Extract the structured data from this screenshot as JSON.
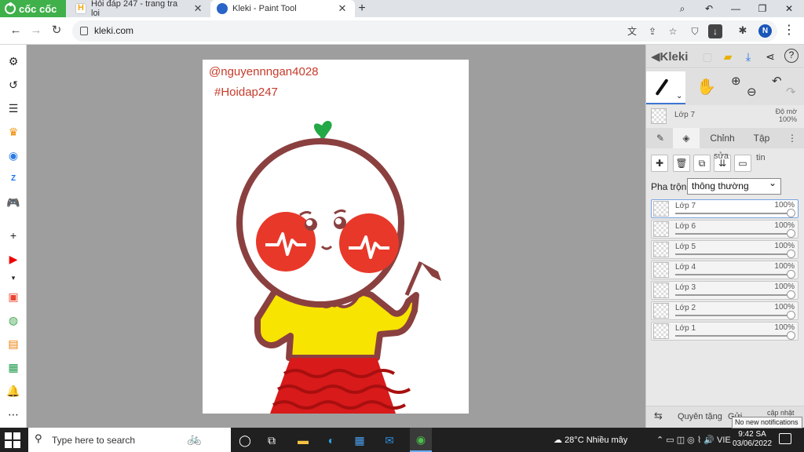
{
  "browser": {
    "brand": "cốc cốc",
    "tabs": [
      {
        "title": "Hỏi đáp 247 - trang tra loi"
      },
      {
        "title": "Kleki - Paint Tool"
      }
    ],
    "url": "kleki.com",
    "profile_initial": "N"
  },
  "canvas": {
    "watermark_1": "@nguyennngan4028",
    "watermark_2": "#Hoidap247"
  },
  "panel": {
    "logo": "Kleki",
    "current_layer": "Lớp 7",
    "opacity_label": [
      "Độ mờ",
      "100%"
    ],
    "tabs": {
      "adjust": "Chỉnh",
      "file": "Tập"
    },
    "toolbar_labels": {
      "edit": "sửa",
      "info": "tin"
    },
    "blend_label": "Pha trộn",
    "blend_value": "thông thường",
    "layers": [
      {
        "name": "Lớp 7",
        "opacity": "100%",
        "active": true
      },
      {
        "name": "Lớp 6",
        "opacity": "100%"
      },
      {
        "name": "Lớp 5",
        "opacity": "100%"
      },
      {
        "name": "Lớp 4",
        "opacity": "100%"
      },
      {
        "name": "Lớp 3",
        "opacity": "100%"
      },
      {
        "name": "Lớp 2",
        "opacity": "100%"
      },
      {
        "name": "Lớp 1",
        "opacity": "100%"
      }
    ],
    "footer": {
      "rotate": "Quyên tặng",
      "help": "Gửi",
      "update": "cập nhật"
    }
  },
  "taskbar": {
    "search_placeholder": "Type here to search",
    "weather": "28°C  Nhiều mây",
    "lang": "VIE",
    "time": "9:42 SA",
    "date": "03/06/2022",
    "tooltip": "No new notifications"
  },
  "colors": {
    "brand_green": "#3fb04a",
    "outline": "#8b4040",
    "shirt": "#f7e400",
    "blush": "#e8382a",
    "dress": "#d81a1a"
  }
}
